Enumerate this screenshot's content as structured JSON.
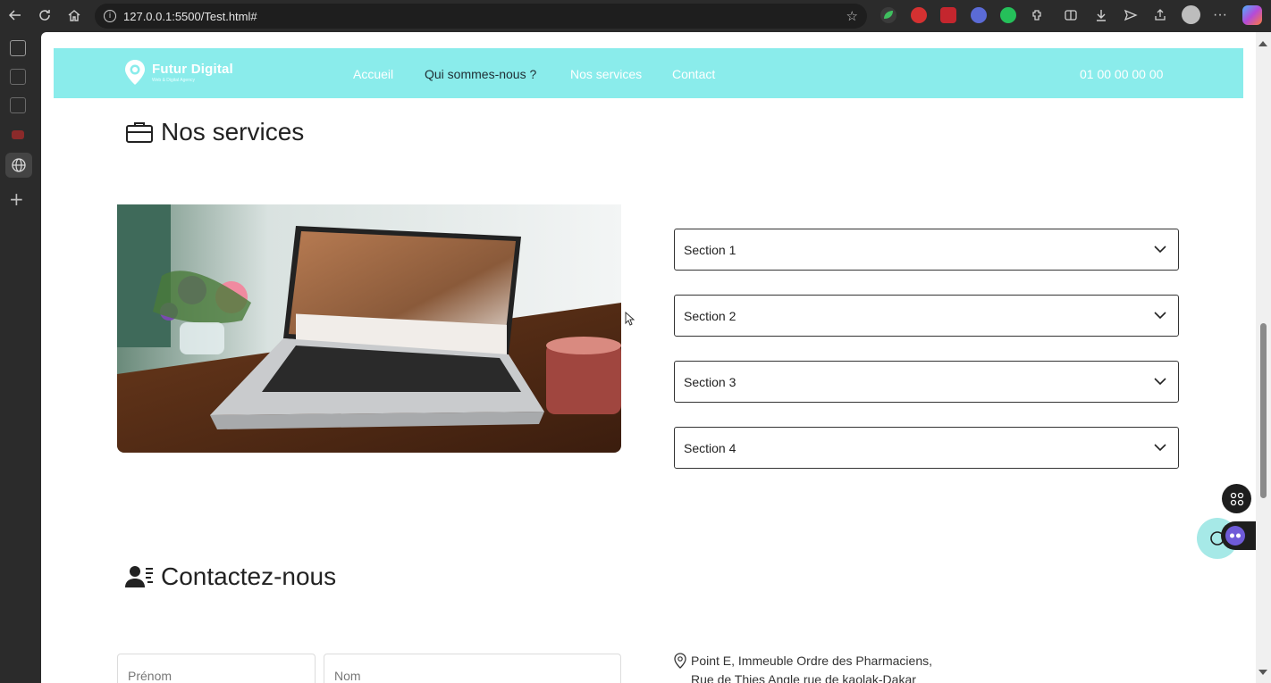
{
  "browser": {
    "url": "127.0.0.1:5500/Test.html#"
  },
  "navbar": {
    "logo_title": "Futur Digital",
    "logo_subtitle": "Web & Digital Agency",
    "links": [
      "Accueil",
      "Qui sommes-nous ?",
      "Nos services",
      "Contact"
    ],
    "active_link": "Qui sommes-nous ?",
    "phone": "01 00 00 00 00",
    "bg_color": "#8aeceb"
  },
  "services": {
    "title": "Nos services",
    "sections": [
      "Section 1",
      "Section 2",
      "Section 3",
      "Section 4"
    ]
  },
  "contact": {
    "title": "Contactez-nous",
    "firstname_placeholder": "Prénom",
    "lastname_placeholder": "Nom",
    "address_line1": "Point E, Immeuble Ordre des Pharmaciens,",
    "address_line2": "Rue de Thies Angle rue de kaolak-Dakar"
  }
}
